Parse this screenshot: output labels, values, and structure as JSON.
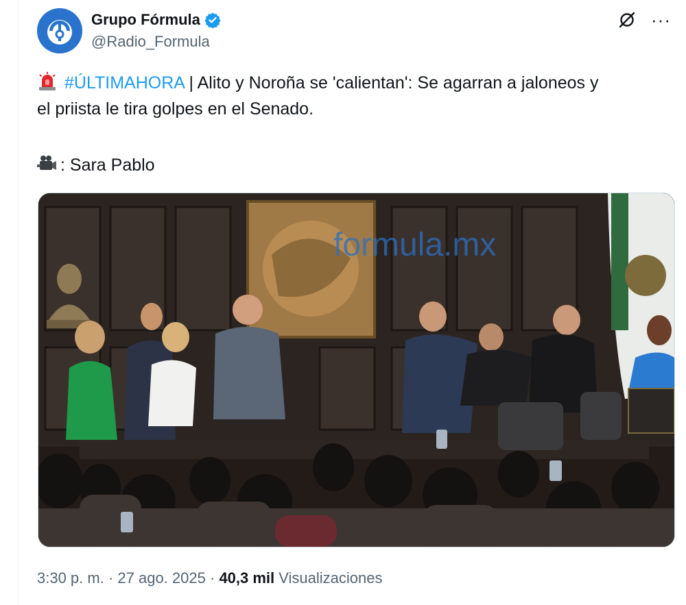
{
  "author": {
    "display_name": "Grupo Fórmula",
    "handle": "@Radio_Formula",
    "verified": true,
    "avatar_icon": "radio-formula-logo-icon",
    "brand_color": "#2a73cc"
  },
  "tweet": {
    "hashtag": "#ÚLTIMAHORA",
    "line1_rest": " | Alito y Noroña se 'calientan': Se agarran a jaloneos y",
    "line2": "el priista le tira golpes en el Senado.",
    "credit": ": Sara Pablo",
    "siren_icon": "siren-emoji-icon",
    "camera_icon": "video-camera-emoji-icon",
    "hashtag_color": "#1d9bf0"
  },
  "media": {
    "watermark": "formula.mx",
    "description_icon": "video-thumbnail"
  },
  "meta": {
    "time": "3:30 p. m.",
    "sep1": " · ",
    "date": "27 ago. 2025",
    "sep2": " · ",
    "views_count": "40,3 mil",
    "views_label": " Visualizaciones"
  },
  "actions": {
    "grok_icon": "grok-icon",
    "more_icon": "more-options-icon",
    "more_glyph": "···"
  }
}
